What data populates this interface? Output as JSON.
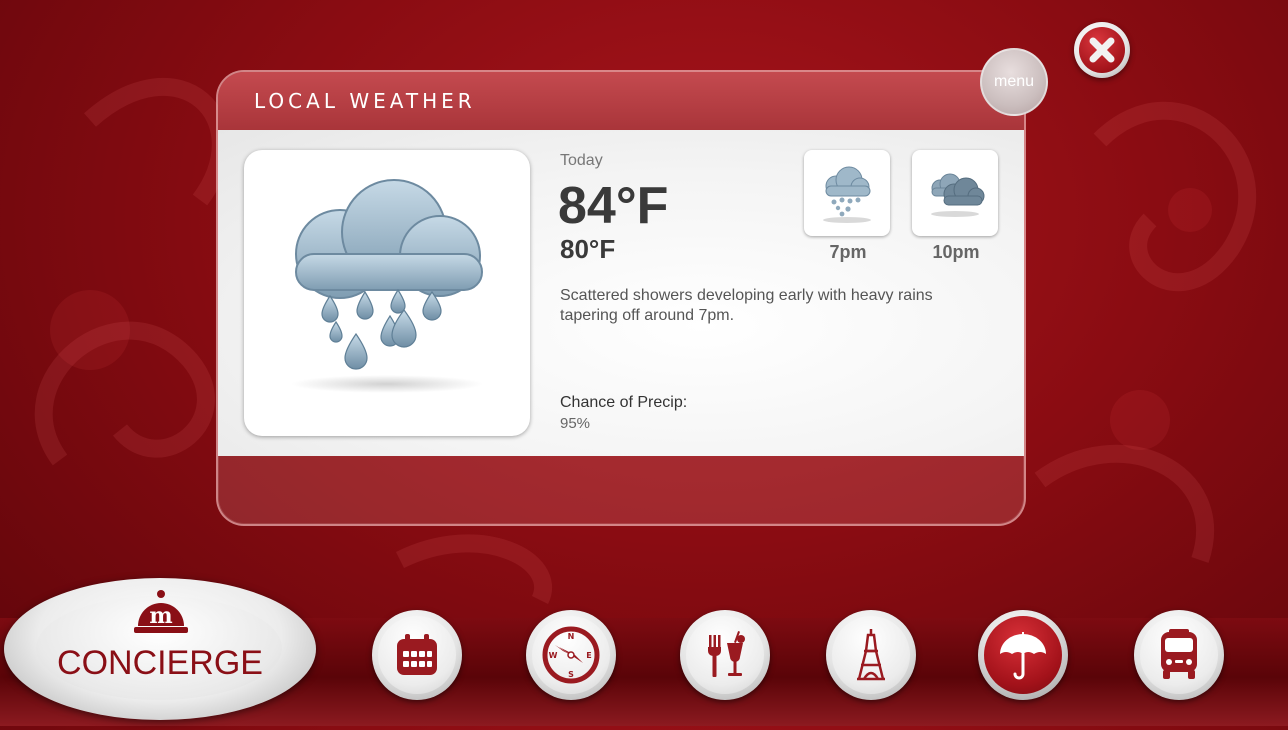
{
  "panel": {
    "title": "LOCAL WEATHER",
    "menu_label": "menu"
  },
  "weather": {
    "current_icon": "rain-cloud-icon",
    "day_label": "Today",
    "temp_high": "84°F",
    "temp_low": "80°F",
    "description": "Scattered showers developing early with heavy rains tapering off around 7pm.",
    "precip_label": "Chance of Precip:",
    "precip_value": "95%"
  },
  "forecast": [
    {
      "time": "7pm",
      "icon": "rain-cloud-icon"
    },
    {
      "time": "10pm",
      "icon": "cloudy-icon"
    }
  ],
  "concierge": {
    "label": "CONCIERGE",
    "logo_letter": "m"
  },
  "nav": [
    {
      "id": "calendar",
      "icon": "calendar-icon"
    },
    {
      "id": "compass",
      "icon": "compass-icon",
      "compass_letters": [
        "N",
        "E",
        "S",
        "W"
      ]
    },
    {
      "id": "dining",
      "icon": "fork-glass-icon"
    },
    {
      "id": "attractions",
      "icon": "eiffel-tower-icon"
    },
    {
      "id": "weather",
      "icon": "umbrella-icon",
      "active": true
    },
    {
      "id": "transport",
      "icon": "bus-icon"
    }
  ],
  "colors": {
    "brand_red": "#8a0f16",
    "accent_red": "#a4141b",
    "panel_header": "#b33b40"
  }
}
